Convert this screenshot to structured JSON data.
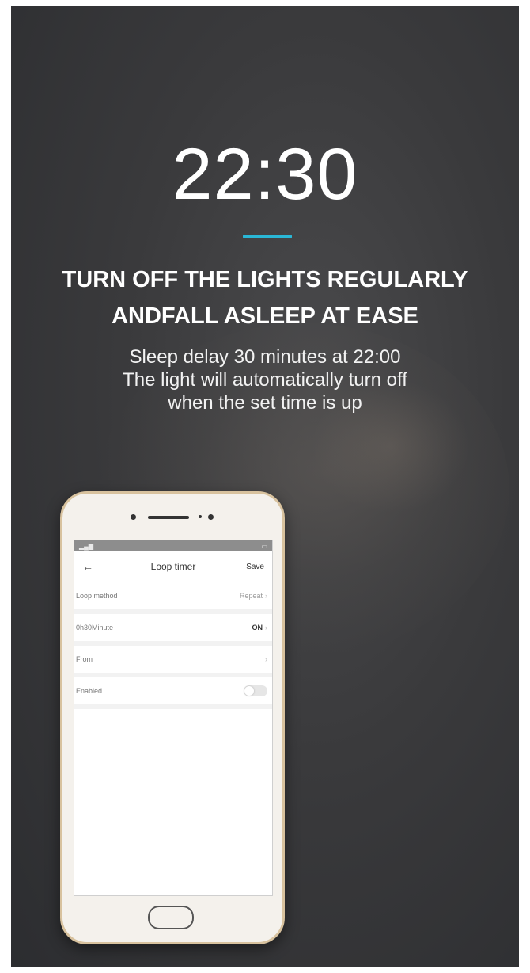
{
  "hero": {
    "time": "22:30",
    "headline_line1": "TURN OFF THE LIGHTS REGULARLY",
    "headline_line2": "ANDFALL ASLEEP AT EASE",
    "desc_line1": "Sleep delay 30 minutes at 22:00",
    "desc_line2": "The light will automatically turn off",
    "desc_line3": "when the set time is up",
    "accent_color": "#2ab7d6"
  },
  "phone_app": {
    "title": "Loop timer",
    "save_label": "Save",
    "rows": [
      {
        "label": "Loop method",
        "value": "Repeat"
      },
      {
        "label": "0h30Minute",
        "value": "ON"
      },
      {
        "label": "From",
        "value": ""
      },
      {
        "label": "Enabled",
        "toggle_on": false
      }
    ]
  }
}
